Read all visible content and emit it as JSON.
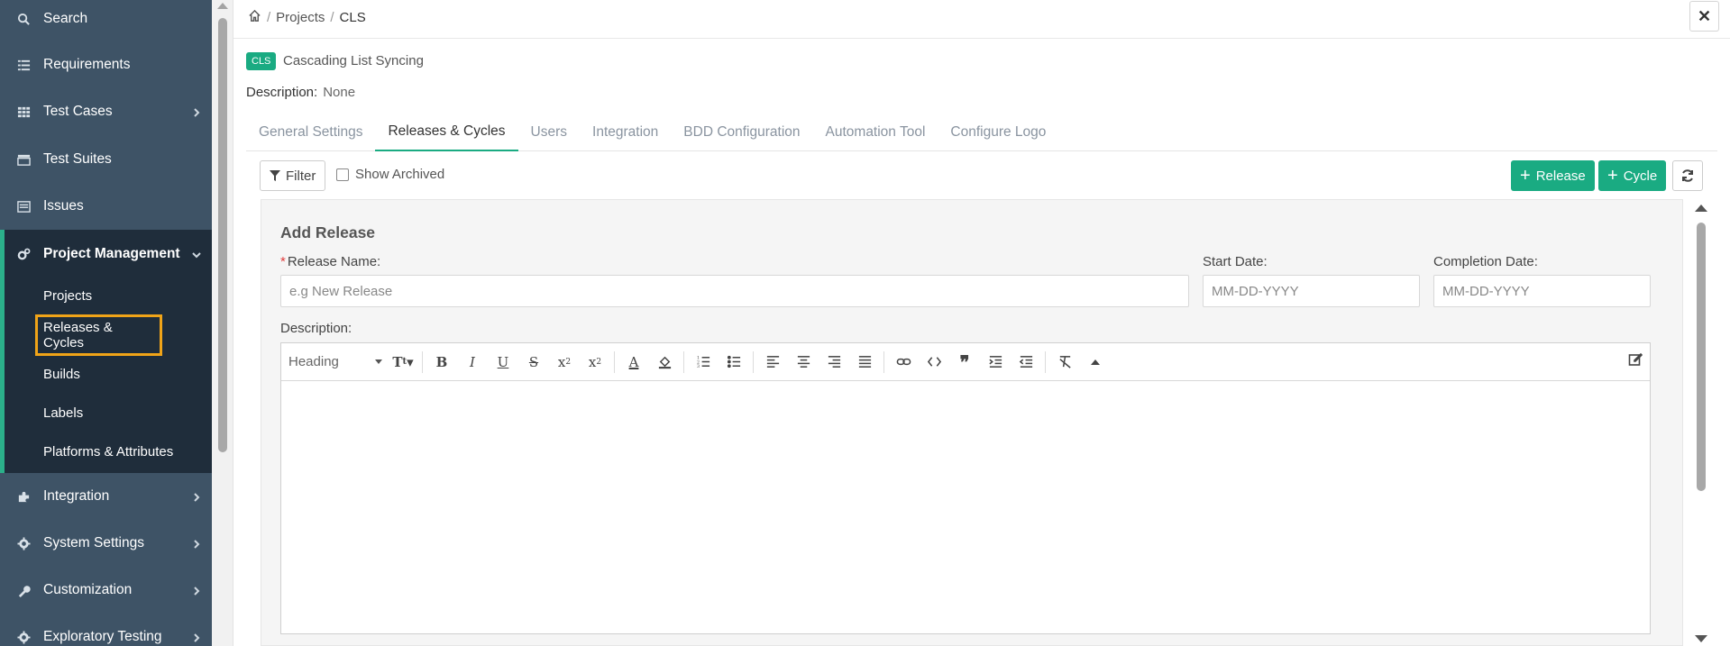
{
  "sidebar": {
    "items": [
      {
        "label": "Search",
        "icon": "search-icon"
      },
      {
        "label": "Requirements",
        "icon": "list-icon"
      },
      {
        "label": "Test Cases",
        "icon": "grid-icon"
      },
      {
        "label": "Test Suites",
        "icon": "table-icon"
      },
      {
        "label": "Issues",
        "icon": "issues-icon"
      },
      {
        "label": "Project Management",
        "icon": "gears-icon"
      },
      {
        "label": "Integration",
        "icon": "puzzle-icon"
      },
      {
        "label": "System Settings",
        "icon": "gear-icon"
      },
      {
        "label": "Customization",
        "icon": "wrench-icon"
      },
      {
        "label": "Exploratory Testing",
        "icon": "gear-icon"
      }
    ],
    "submenu": [
      "Projects",
      "Releases & Cycles",
      "Builds",
      "Labels",
      "Platforms & Attributes"
    ],
    "selected_submenu": "Releases & Cycles",
    "colors": {
      "background": "#3e5366",
      "active_group": "#1f2d3b",
      "accent": "#2bb08a",
      "highlight": "#f0a418"
    }
  },
  "breadcrumb": {
    "items": [
      "Projects",
      "CLS"
    ],
    "home_icon": "home-icon"
  },
  "project": {
    "badge": "CLS",
    "name": "Cascading List Syncing",
    "description_label": "Description:",
    "description_value": "None"
  },
  "tabs": [
    "General Settings",
    "Releases & Cycles",
    "Users",
    "Integration",
    "BDD Configuration",
    "Automation Tool",
    "Configure Logo"
  ],
  "active_tab": "Releases & Cycles",
  "toolbar": {
    "filter_label": "Filter",
    "show_archived_label": "Show Archived",
    "add_release_label": "Release",
    "add_cycle_label": "Cycle"
  },
  "form": {
    "title": "Add Release",
    "release_name_label": "Release Name:",
    "release_name_placeholder": "e.g New Release",
    "start_date_label": "Start Date:",
    "start_date_placeholder": "MM-DD-YYYY",
    "completion_date_label": "Completion Date:",
    "completion_date_placeholder": "MM-DD-YYYY",
    "description_label": "Description:",
    "editor_heading": "Heading"
  },
  "accent_color": "#1aab82"
}
